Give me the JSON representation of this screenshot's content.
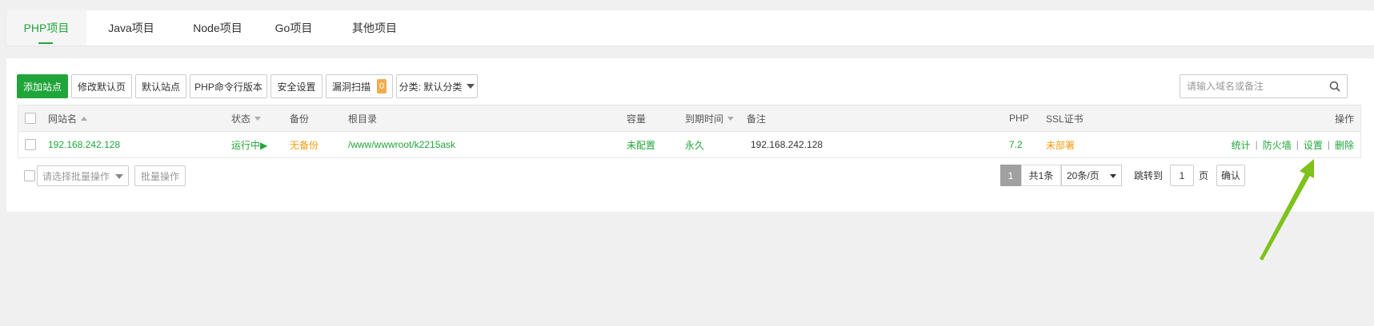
{
  "tabs": [
    {
      "label": "PHP项目",
      "active": true
    },
    {
      "label": "Java项目"
    },
    {
      "label": "Node项目"
    },
    {
      "label": "Go项目"
    },
    {
      "label": "其他项目"
    }
  ],
  "toolbar": {
    "add_site": "添加站点",
    "edit_default_page": "修改默认页",
    "default_site": "默认站点",
    "php_cli_version": "PHP命令行版本",
    "security_settings": "安全设置",
    "vuln_scan": "漏洞扫描",
    "vuln_count": "0",
    "category": "分类: 默认分类"
  },
  "search": {
    "placeholder": "请输入域名或备注"
  },
  "table": {
    "headers": {
      "site_name": "网站名",
      "status": "状态",
      "backup": "备份",
      "root": "根目录",
      "capacity": "容量",
      "expire": "到期时间",
      "remark": "备注",
      "php": "PHP",
      "ssl": "SSL证书",
      "actions": "操作"
    },
    "rows": [
      {
        "site_name": "192.168.242.128",
        "status": "运行中▶",
        "backup": "无备份",
        "root": "/www/wwwroot/k2215ask",
        "capacity": "未配置",
        "expire": "永久",
        "remark": "192.168.242.128",
        "php": "7.2",
        "ssl": "未部署",
        "actions": {
          "stats": "统计",
          "firewall": "防火墙",
          "settings": "设置",
          "delete": "删除",
          "sep": "|"
        }
      }
    ]
  },
  "batch": {
    "select_placeholder": "请选择批量操作",
    "button": "批量操作"
  },
  "pagination": {
    "current": "1",
    "total": "共1条",
    "page_size": "20条/页",
    "jump_label": "跳转到",
    "jump_value": "1",
    "page_unit": "页",
    "confirm": "确认"
  },
  "colors": {
    "accent": "#20a53a",
    "warning": "#f39c12",
    "annotation_arrow": "#7ec21a"
  }
}
